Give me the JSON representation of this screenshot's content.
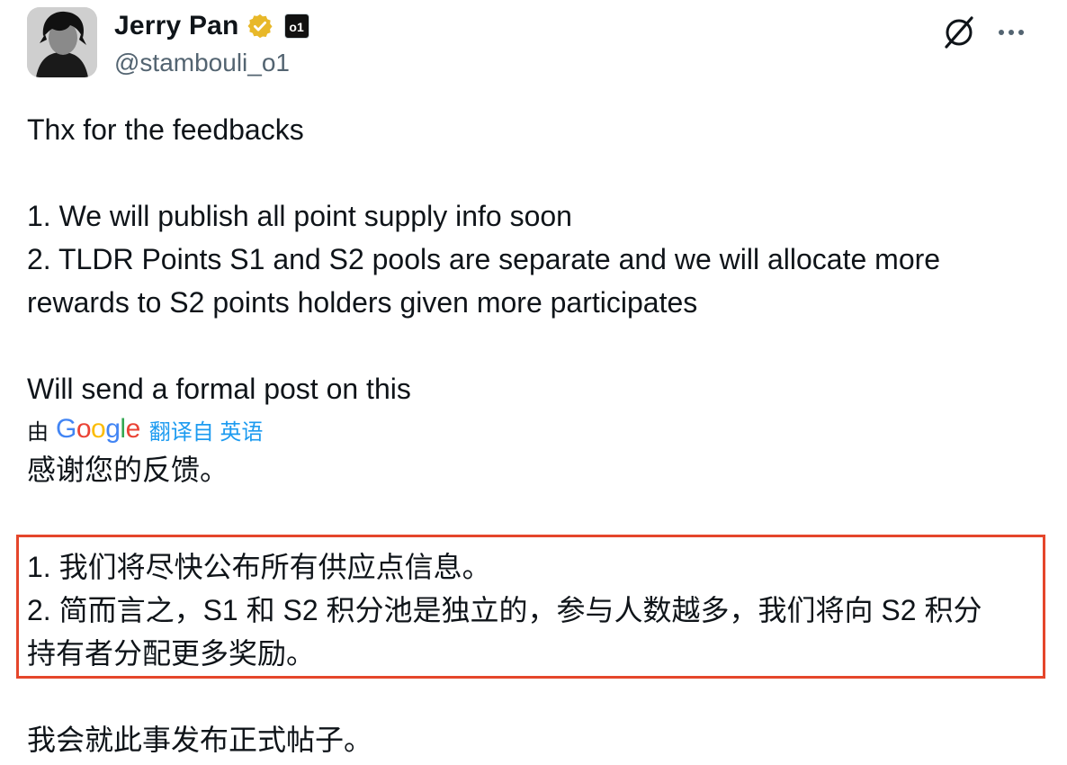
{
  "author": {
    "name": "Jerry Pan",
    "handle": "@stambouli_o1",
    "affiliate_badge": "o1",
    "verified": true
  },
  "icons": {
    "grok": "grok-icon",
    "more": "more-icon",
    "verified": "verified-badge-icon"
  },
  "colors": {
    "text": "#0f1419",
    "secondary": "#536471",
    "link": "#1d9bf0",
    "verified_gold": "#e8b829",
    "highlight_border": "#e5462b"
  },
  "post": {
    "en_line1": "Thx for the feedbacks",
    "en_line2": "1. We will publish all point supply info soon",
    "en_line3": "2. TLDR Points S1 and S2 pools are separate and we will allocate more",
    "en_line4": "rewards to S2 points holders given more participates",
    "en_line5": "Will send a formal post on this"
  },
  "translation": {
    "by_label": "由",
    "provider": "Google",
    "from_label": "翻译自 英语",
    "zh_line1": "感谢您的反馈。",
    "zh_line2": "1. 我们将尽快公布所有供应点信息。",
    "zh_line3": "2. 简而言之，S1 和 S2 积分池是独立的，参与人数越多，我们将向 S2 积分",
    "zh_line4": "持有者分配更多奖励。",
    "zh_line5": "我会就此事发布正式帖子。"
  }
}
